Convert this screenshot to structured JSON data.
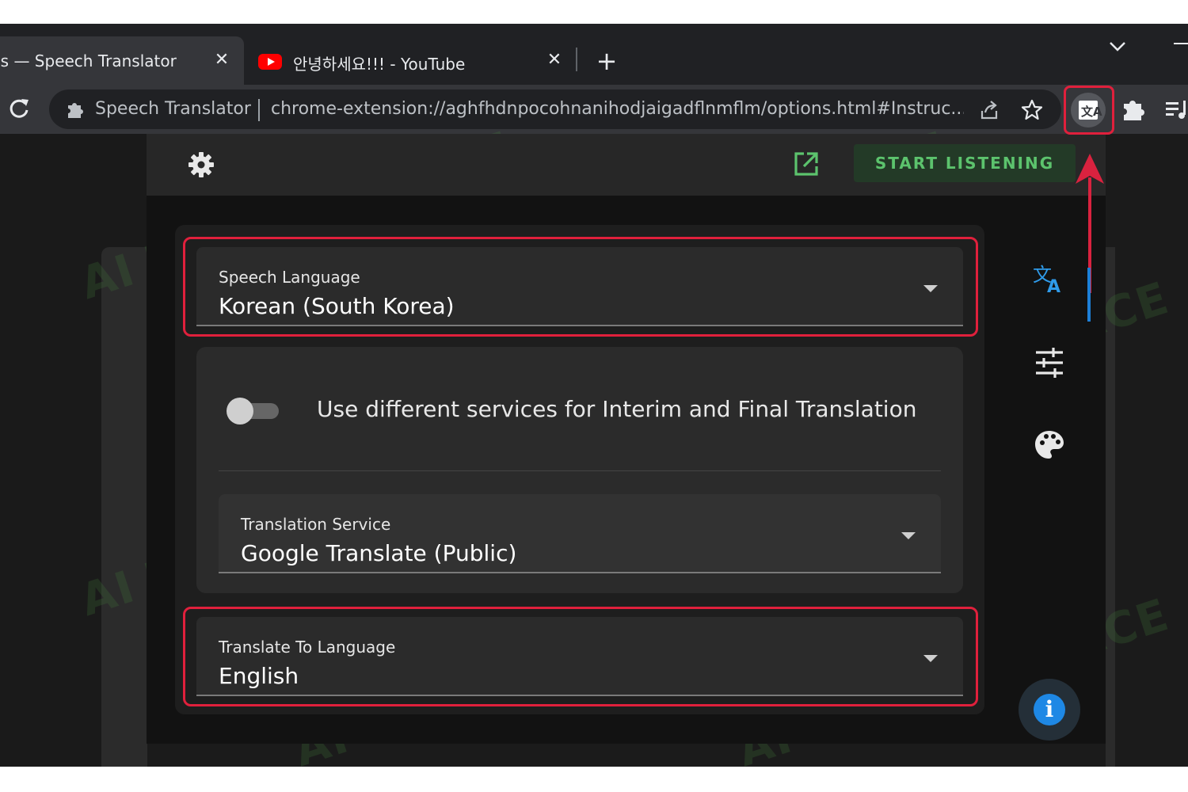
{
  "browser": {
    "tabs": [
      {
        "title": "ns — Speech Translator",
        "close": "✕",
        "active": true
      },
      {
        "title": "안녕하세요!!! - YouTube",
        "close": "✕",
        "active": false,
        "icon": "youtube-icon"
      }
    ],
    "new_tab": "+",
    "site_chip": "Speech Translator",
    "url": "chrome-extension://aghfhdnpocohnanihodjaigadflnmflm/options.html#Instruc..."
  },
  "popup": {
    "start_button": "START LISTENING",
    "speech_language": {
      "label": "Speech Language",
      "value": "Korean (South Korea)"
    },
    "toggle_label": "Use different services for Interim and Final Translation",
    "toggle_on": false,
    "translation_service": {
      "label": "Translation Service",
      "value": "Google Translate (Public)"
    },
    "target_language": {
      "label": "Translate To Language",
      "value": "English"
    }
  },
  "watermark": "AI TALENT SPACE",
  "colors": {
    "highlight": "#e0203c",
    "start_text": "#5cc36d",
    "accent_blue": "#1e88e5",
    "popup_bg": "#121212"
  }
}
